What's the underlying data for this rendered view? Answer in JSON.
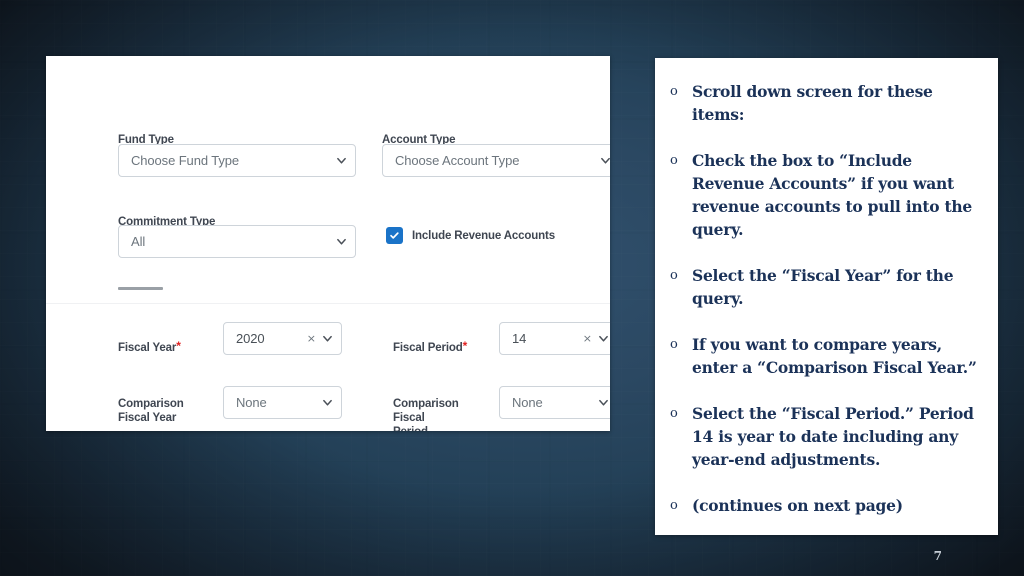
{
  "slide": {
    "page_number": "7",
    "background_color": "#2b4862",
    "accent_color": "#1a73c8",
    "bullet_text_color": "#1b3258"
  },
  "form": {
    "fields": [
      {
        "label": "Fund Type",
        "value": "Choose Fund Type",
        "filled": false,
        "required": false,
        "clearable": false
      },
      {
        "label": "Account Type",
        "value": "Choose Account Type",
        "filled": false,
        "required": false,
        "clearable": false
      },
      {
        "label": "Commitment Type",
        "value": "All",
        "filled": false,
        "required": false,
        "clearable": false
      },
      {
        "label": "Fiscal Year",
        "value": "2020",
        "filled": true,
        "required": true,
        "clearable": true
      },
      {
        "label": "Fiscal Period",
        "value": "14",
        "filled": true,
        "required": true,
        "clearable": true
      },
      {
        "label": "Comparison\nFiscal Year",
        "value": "None",
        "filled": false,
        "required": false,
        "clearable": false
      },
      {
        "label": "Comparison\nFiscal\nPeriod",
        "value": "None",
        "filled": false,
        "required": false,
        "clearable": false
      }
    ],
    "checkbox": {
      "label": "Include Revenue Accounts",
      "checked": true
    },
    "required_marker": "*",
    "clear_marker": "×"
  },
  "notes": {
    "marker": "o",
    "items": [
      "Scroll down screen for these items:",
      "Check the box to “Include Revenue Accounts” if you want revenue accounts to pull into the query.",
      "Select the “Fiscal Year” for the query.",
      "If you want to compare years, enter a “Comparison Fiscal Year.”",
      "Select the “Fiscal Period.” Period 14 is year to date including any year-end adjustments.",
      "(continues on next page)"
    ]
  }
}
